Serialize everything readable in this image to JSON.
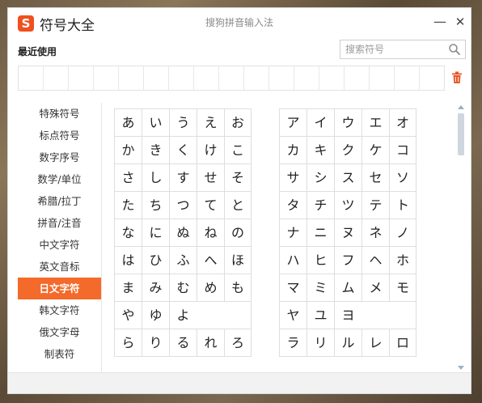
{
  "window": {
    "logo_glyph": "S",
    "title": "符号大全",
    "subtitle": "搜狗拼音输入法",
    "minimize_glyph": "—",
    "close_glyph": "✕"
  },
  "recent": {
    "label": "最近使用",
    "slots": 17
  },
  "search": {
    "placeholder": "搜索符号"
  },
  "sidebar": {
    "items": [
      {
        "label": "特殊符号"
      },
      {
        "label": "标点符号"
      },
      {
        "label": "数字序号"
      },
      {
        "label": "数学/单位"
      },
      {
        "label": "希腊/拉丁"
      },
      {
        "label": "拼音/注音"
      },
      {
        "label": "中文字符"
      },
      {
        "label": "英文音标"
      },
      {
        "label": "日文字符",
        "active": true
      },
      {
        "label": "韩文字符"
      },
      {
        "label": "俄文字母"
      },
      {
        "label": "制表符"
      }
    ]
  },
  "hiragana": [
    [
      "あ",
      "い",
      "う",
      "え",
      "お"
    ],
    [
      "か",
      "き",
      "く",
      "け",
      "こ"
    ],
    [
      "さ",
      "し",
      "す",
      "せ",
      "そ"
    ],
    [
      "た",
      "ち",
      "つ",
      "て",
      "と"
    ],
    [
      "な",
      "に",
      "ぬ",
      "ね",
      "の"
    ],
    [
      "は",
      "ひ",
      "ふ",
      "へ",
      "ほ"
    ],
    [
      "ま",
      "み",
      "む",
      "め",
      "も"
    ],
    [
      "や",
      "ゆ",
      "よ",
      "",
      ""
    ],
    [
      "ら",
      "り",
      "る",
      "れ",
      "ろ"
    ]
  ],
  "katakana": [
    [
      "ア",
      "イ",
      "ウ",
      "エ",
      "オ"
    ],
    [
      "カ",
      "キ",
      "ク",
      "ケ",
      "コ"
    ],
    [
      "サ",
      "シ",
      "ス",
      "セ",
      "ソ"
    ],
    [
      "タ",
      "チ",
      "ツ",
      "テ",
      "ト"
    ],
    [
      "ナ",
      "ニ",
      "ヌ",
      "ネ",
      "ノ"
    ],
    [
      "ハ",
      "ヒ",
      "フ",
      "ヘ",
      "ホ"
    ],
    [
      "マ",
      "ミ",
      "ム",
      "メ",
      "モ"
    ],
    [
      "ヤ",
      "ユ",
      "ヨ",
      "",
      ""
    ],
    [
      "ラ",
      "リ",
      "ル",
      "レ",
      "ロ"
    ]
  ],
  "colors": {
    "accent": "#f46a2a",
    "logo": "#f0501e"
  },
  "icons": {
    "search": "search-icon",
    "trash": "trash-icon"
  }
}
